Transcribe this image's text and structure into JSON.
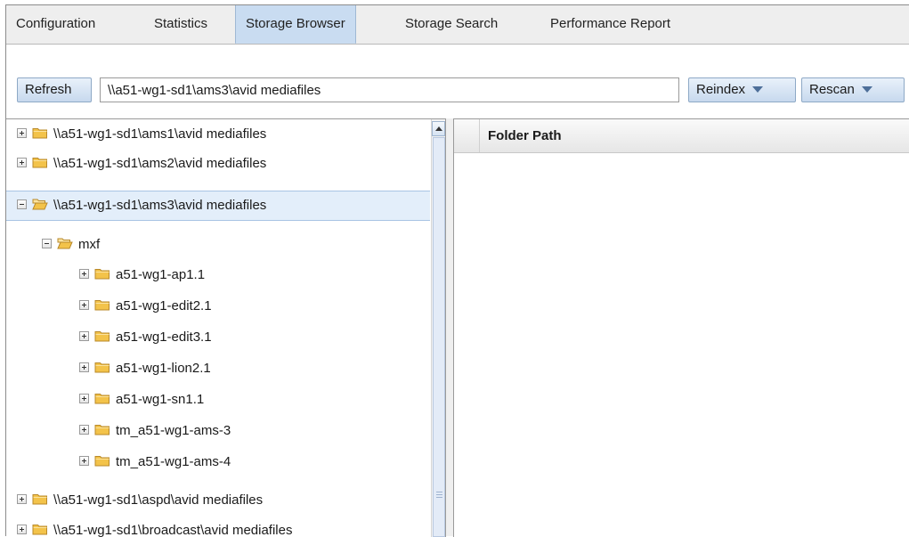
{
  "tabs": [
    {
      "label": "Configuration",
      "active": false
    },
    {
      "label": "Statistics",
      "active": false
    },
    {
      "label": "Storage Browser",
      "active": true
    },
    {
      "label": "Storage Search",
      "active": false
    },
    {
      "label": "Performance Report",
      "active": false
    }
  ],
  "toolbar": {
    "refresh_label": "Refresh",
    "path_value": "\\\\a51-wg1-sd1\\ams3\\avid mediafiles",
    "reindex_label": "Reindex",
    "rescan_label": "Rescan"
  },
  "tree": [
    {
      "label": "\\\\a51-wg1-sd1\\ams1\\avid mediafiles",
      "level": 0,
      "expanded": false,
      "selected": false
    },
    {
      "label": "\\\\a51-wg1-sd1\\ams2\\avid mediafiles",
      "level": 0,
      "expanded": false,
      "selected": false
    },
    {
      "label": "\\\\a51-wg1-sd1\\ams3\\avid mediafiles",
      "level": 0,
      "expanded": true,
      "selected": true
    },
    {
      "label": "mxf",
      "level": 1,
      "expanded": true,
      "selected": false
    },
    {
      "label": "a51-wg1-ap1.1",
      "level": 2,
      "expanded": false,
      "selected": false
    },
    {
      "label": "a51-wg1-edit2.1",
      "level": 2,
      "expanded": false,
      "selected": false
    },
    {
      "label": "a51-wg1-edit3.1",
      "level": 2,
      "expanded": false,
      "selected": false
    },
    {
      "label": "a51-wg1-lion2.1",
      "level": 2,
      "expanded": false,
      "selected": false
    },
    {
      "label": "a51-wg1-sn1.1",
      "level": 2,
      "expanded": false,
      "selected": false
    },
    {
      "label": "tm_a51-wg1-ams-3",
      "level": 2,
      "expanded": false,
      "selected": false
    },
    {
      "label": "tm_a51-wg1-ams-4",
      "level": 2,
      "expanded": false,
      "selected": false
    },
    {
      "label": "\\\\a51-wg1-sd1\\aspd\\avid mediafiles",
      "level": 0,
      "expanded": false,
      "selected": false
    },
    {
      "label": "\\\\a51-wg1-sd1\\broadcast\\avid mediafiles",
      "level": 0,
      "expanded": false,
      "selected": false
    }
  ],
  "results": {
    "column_header": "Folder Path",
    "rows": []
  },
  "colors": {
    "accent": "#c9dcf1",
    "folder": "#f3c34a",
    "selection": "#e3eefa"
  }
}
